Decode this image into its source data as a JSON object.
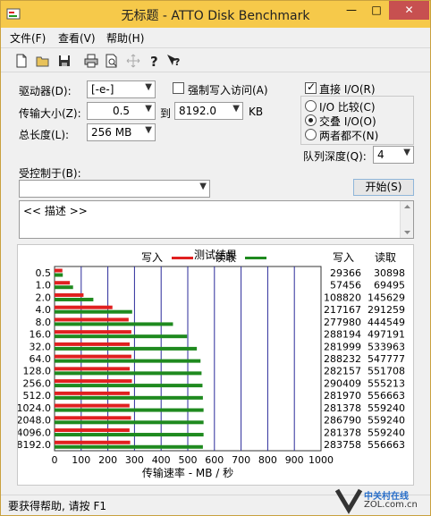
{
  "window": {
    "title": "无标题 - ATTO Disk Benchmark"
  },
  "titlebar": {
    "min": "—",
    "max": "□",
    "close": "✕"
  },
  "menu": {
    "file": "文件(F)",
    "view": "查看(V)",
    "help": "帮助(H)"
  },
  "controls": {
    "drive_label": "驱动器(D):",
    "drive_value": "[-e-]",
    "force_write_label": "强制写入访问(A)",
    "transfer_size_label": "传输大小(Z):",
    "transfer_from": "0.5",
    "to_label": "到",
    "transfer_to": "8192.0",
    "kb_label": "KB",
    "total_length_label": "总长度(L):",
    "total_length_value": "256 MB",
    "direct_io_label": "直接 I/O(R)",
    "io_compare_label": "I/O 比较(C)",
    "overlapped_io_label": "交叠 I/O(O)",
    "neither_label": "两者都不(N)",
    "queue_depth_label": "队列深度(Q):",
    "queue_depth_value": "4",
    "controlled_by_label": "受控制于(B):",
    "controlled_by_value": "",
    "start_button": "开始(S)",
    "description": "<< 描述 >>"
  },
  "results": {
    "title": "测试结果",
    "legend_write": "写入",
    "legend_read": "读取",
    "col_write": "写入",
    "col_read": "读取"
  },
  "chart_data": {
    "type": "bar",
    "orientation": "horizontal",
    "title": "测试结果",
    "xlabel": "传输速率 - MB / 秒",
    "xlim": [
      0,
      1000
    ],
    "xticks": [
      0,
      100,
      200,
      300,
      400,
      500,
      600,
      700,
      800,
      900,
      1000
    ],
    "grid": true,
    "legend": "top-center",
    "categories": [
      "0.5",
      "1.0",
      "2.0",
      "4.0",
      "8.0",
      "16.0",
      "32.0",
      "64.0",
      "128.0",
      "256.0",
      "512.0",
      "1024.0",
      "2048.0",
      "4096.0",
      "8192.0"
    ],
    "series": [
      {
        "name": "写入",
        "color": "#e02020",
        "values": [
          29.4,
          57.5,
          108.8,
          217.2,
          278.0,
          288.2,
          282.0,
          288.2,
          282.2,
          290.4,
          282.0,
          281.4,
          286.8,
          281.4,
          283.8
        ],
        "labels": [
          "29366",
          "57456",
          "108820",
          "217167",
          "277980",
          "288194",
          "281999",
          "288232",
          "282157",
          "290409",
          "281970",
          "281378",
          "286790",
          "281378",
          "283758"
        ]
      },
      {
        "name": "读取",
        "color": "#1f8a1f",
        "values": [
          30.9,
          69.5,
          145.6,
          291.3,
          444.5,
          497.2,
          534.0,
          547.8,
          551.7,
          555.2,
          556.7,
          559.2,
          559.2,
          559.2,
          556.7
        ],
        "labels": [
          "30898",
          "69495",
          "145629",
          "291259",
          "444549",
          "497191",
          "533963",
          "547777",
          "551708",
          "555213",
          "556663",
          "559240",
          "559240",
          "559240",
          "556663"
        ]
      }
    ]
  },
  "status": {
    "text": "要获得帮助, 请按 F1"
  },
  "watermark": {
    "cn": "中关村在线",
    "url": "ZOL.com.cn"
  }
}
